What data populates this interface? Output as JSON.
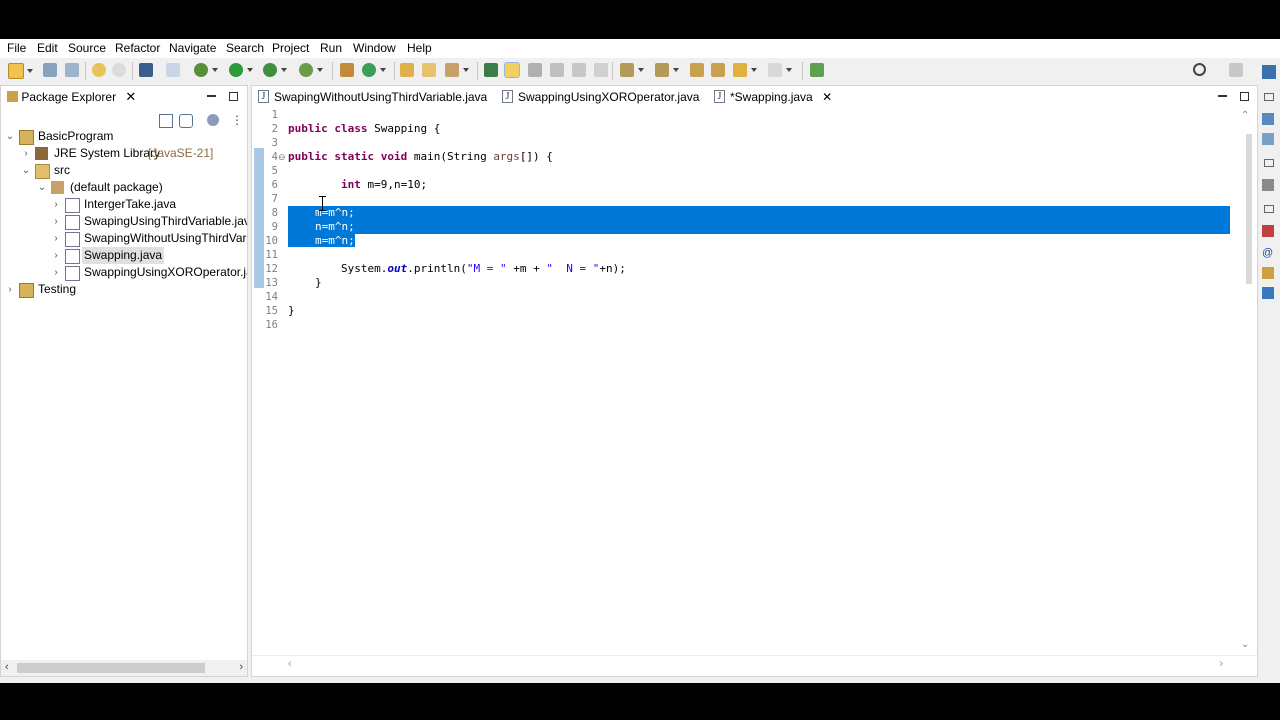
{
  "menu": [
    "File",
    "Edit",
    "Source",
    "Refactor",
    "Navigate",
    "Search",
    "Project",
    "Run",
    "Window",
    "Help"
  ],
  "package_explorer": {
    "title": "Package Explorer",
    "tree": [
      {
        "label": "BasicProgram",
        "icon": "project-icon"
      },
      {
        "label": "JRE System Library",
        "suffix": "[JavaSE-21]",
        "icon": "library-icon"
      },
      {
        "label": "src",
        "icon": "source-folder-icon"
      },
      {
        "label": "(default package)",
        "icon": "package-icon"
      },
      {
        "label": "IntergerTake.java",
        "icon": "java-file-icon"
      },
      {
        "label": "SwapingUsingThirdVariable.java",
        "icon": "java-file-icon"
      },
      {
        "label": "SwapingWithoutUsingThirdVariab",
        "icon": "java-file-icon"
      },
      {
        "label": "Swapping.java",
        "icon": "java-file-icon"
      },
      {
        "label": "SwappingUsingXOROperator.java",
        "icon": "java-file-icon"
      },
      {
        "label": "Testing",
        "icon": "project-icon"
      }
    ]
  },
  "editor": {
    "tabs": [
      {
        "label": "SwapingWithoutUsingThirdVariable.java"
      },
      {
        "label": "SwappingUsingXOROperator.java"
      },
      {
        "label": "*Swapping.java"
      }
    ],
    "line_numbers": [
      "1",
      "2",
      "3",
      "4",
      "5",
      "6",
      "7",
      "8",
      "9",
      "10",
      "11",
      "12",
      "13",
      "14",
      "15",
      "16"
    ],
    "code": {
      "l2_kw": "public class",
      "l2_rest": " Swapping {",
      "l4_kw": "public static void",
      "l4_rest": " main(String ",
      "l4_param": "args",
      "l4_end": "[]) {",
      "l6_kw": "int",
      "l6_rest": " m=9,n=10;",
      "l8": "m=m^n;",
      "l9": "n=m^n;",
      "l10": "m=m^n;",
      "l12_a": "System.",
      "l12_field": "out",
      "l12_b": ".println(",
      "l12_s1": "\"M = \"",
      "l12_c": " +m + ",
      "l12_s2": "\"  N = \"",
      "l12_d": "+n);",
      "l13": "}",
      "l15": "}"
    }
  },
  "colors": {
    "selection": "#0078d7",
    "keyword": "#7f0055",
    "string": "#2a00ff"
  }
}
